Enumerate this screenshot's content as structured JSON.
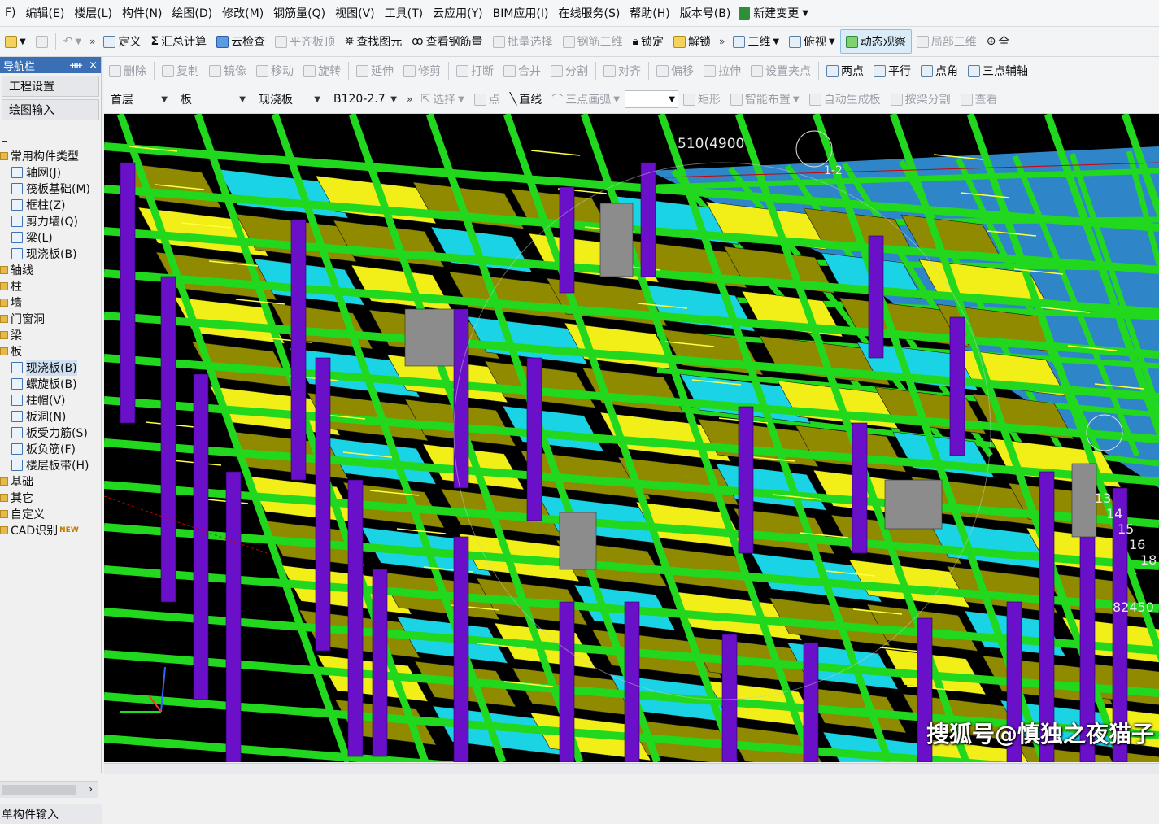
{
  "menu": [
    "F)",
    "编辑(E)",
    "楼层(L)",
    "构件(N)",
    "绘图(D)",
    "修改(M)",
    "钢筋量(Q)",
    "视图(V)",
    "工具(T)",
    "云应用(Y)",
    "BIM应用(I)",
    "在线服务(S)",
    "帮助(H)",
    "版本号(B)"
  ],
  "menu_new_change": "新建变更",
  "toolbar1": {
    "define": "定义",
    "sum_calc": "汇总计算",
    "cloud_check": "云检查",
    "level_slab_top": "平齐板顶",
    "find_element": "查找图元",
    "view_rebar": "查看钢筋量",
    "batch_select": "批量选择",
    "rebar_3d": "钢筋三维",
    "lock": "锁定",
    "unlock": "解锁",
    "three_d": "三维",
    "plan_view": "俯视",
    "dynamic_observe": "动态观察",
    "local_3d": "局部三维",
    "all": "全"
  },
  "toolbar2": [
    "删除",
    "复制",
    "镜像",
    "移动",
    "旋转",
    "延伸",
    "修剪",
    "打断",
    "合并",
    "分割",
    "对齐",
    "偏移",
    "拉伸",
    "设置夹点",
    "两点",
    "平行",
    "点角",
    "三点辅轴"
  ],
  "toolbar3": {
    "floor": "首层",
    "category": "板",
    "type": "现浇板",
    "name": "B120-2.7",
    "select": "选择",
    "point": "点",
    "line": "直线",
    "arc": "三点画弧",
    "rect": "矩形",
    "smart_layout": "智能布置",
    "auto_slab": "自动生成板",
    "by_beam_split": "按梁分割",
    "view": "查看"
  },
  "nav": {
    "title": "导航栏",
    "pin": "ᚓ",
    "close": "×",
    "btn_project": "工程设置",
    "btn_draw": "绘图输入",
    "tree": [
      {
        "label": "常用构件类型",
        "kind": "cat"
      },
      {
        "label": "轴网(J)",
        "kind": "sub"
      },
      {
        "label": "筏板基础(M)",
        "kind": "sub"
      },
      {
        "label": "框柱(Z)",
        "kind": "sub"
      },
      {
        "label": "剪力墙(Q)",
        "kind": "sub"
      },
      {
        "label": "梁(L)",
        "kind": "sub"
      },
      {
        "label": "现浇板(B)",
        "kind": "sub"
      },
      {
        "label": "轴线",
        "kind": "cat"
      },
      {
        "label": "柱",
        "kind": "cat"
      },
      {
        "label": "墙",
        "kind": "cat"
      },
      {
        "label": "门窗洞",
        "kind": "cat"
      },
      {
        "label": "梁",
        "kind": "cat"
      },
      {
        "label": "板",
        "kind": "cat"
      },
      {
        "label": "现浇板(B)",
        "kind": "sub",
        "selected": true
      },
      {
        "label": "螺旋板(B)",
        "kind": "sub"
      },
      {
        "label": "柱帽(V)",
        "kind": "sub"
      },
      {
        "label": "板洞(N)",
        "kind": "sub"
      },
      {
        "label": "板受力筋(S)",
        "kind": "sub"
      },
      {
        "label": "板负筋(F)",
        "kind": "sub"
      },
      {
        "label": "楼层板带(H)",
        "kind": "sub"
      },
      {
        "label": "基础",
        "kind": "cat"
      },
      {
        "label": "其它",
        "kind": "cat"
      },
      {
        "label": "自定义",
        "kind": "cat"
      },
      {
        "label": "CAD识别",
        "kind": "cat",
        "badge": "NEW"
      }
    ],
    "single_input": "单构件输入"
  },
  "viewport": {
    "dim_top": "510(4900",
    "axis_label": "1-2",
    "axis_numbers": [
      "13",
      "14",
      "15",
      "16",
      "18"
    ],
    "dim_right": "82450",
    "watermark": "搜狐号@慎独之夜猫子"
  },
  "colors": {
    "beam": "#22d81e",
    "column": "#6a10c8",
    "slab_olive": "#8f8a00",
    "slab_yellow": "#f2ee18",
    "slab_magenta": "#ee1aea",
    "slab_blue": "#2e86c9",
    "slab_cyan": "#1ad4e6",
    "background": "#000000"
  }
}
